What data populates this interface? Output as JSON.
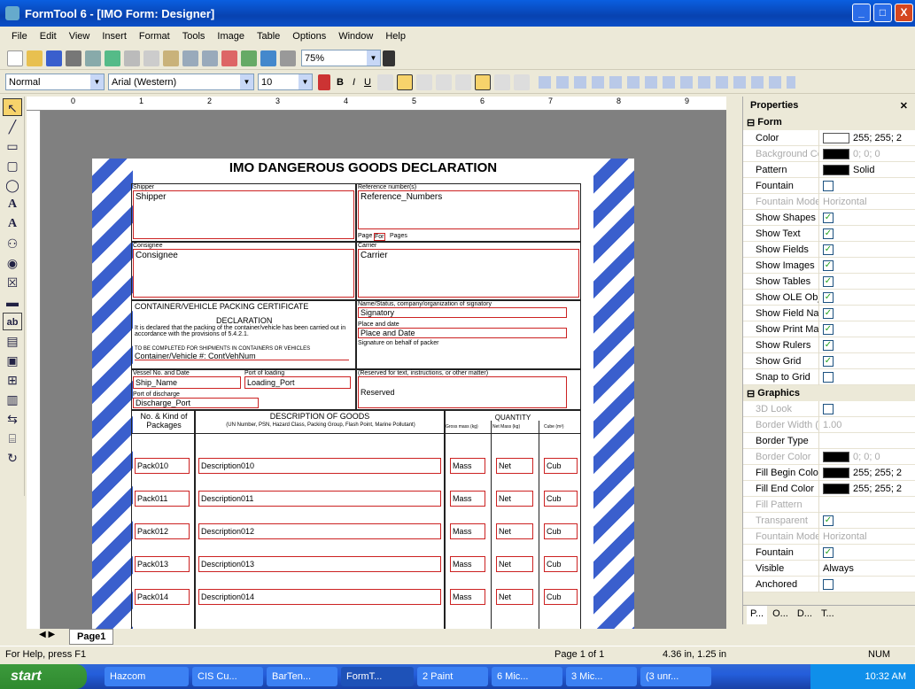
{
  "window": {
    "title": "FormTool 6 - [IMO Form: Designer]",
    "min": "_",
    "max": "□",
    "close": "X"
  },
  "menu": [
    "File",
    "Edit",
    "View",
    "Insert",
    "Format",
    "Tools",
    "Image",
    "Table",
    "Options",
    "Window",
    "Help"
  ],
  "toolbar": {
    "zoom": "75%",
    "style": "Normal",
    "font": "Arial (Western)",
    "size": "10"
  },
  "document": {
    "title": "IMO DANGEROUS GOODS DECLARATION",
    "shipper_label": "Shipper",
    "shipper_field": "Shipper",
    "ref_label": "Reference number(s)",
    "ref_field": "Reference_Numbers",
    "page_label": "Page",
    "page_for": "For",
    "page_pages": "Pages",
    "consignee_label": "Consignee",
    "consignee_field": "Consignee",
    "carrier_label": "Carrier",
    "carrier_field": "Carrier",
    "cert_heading": "CONTAINER/VEHICLE PACKING CERTIFICATE",
    "decl_heading": "DECLARATION",
    "decl_text": "It is declared that the packing of the container/vehicle has been carried out in accordance with the provisions of 5.4.2.1.",
    "sig_label": "Name/Status, company/organization of signatory",
    "sig_field": "Signatory",
    "place_label": "Place and date",
    "place_field": "Place and Date",
    "sig_behalf": "Signature on behalf of packer",
    "container_label": "TO BE COMPLETED FOR SHIPMENTS IN CONTAINERS OR VEHICLES",
    "container_field": "Container/Vehicle #:  ContVehNum",
    "vessel_label": "Vessel No. and Date",
    "vessel_field": "Ship_Name",
    "loading_label": "Port of loading",
    "loading_field": "Loading_Port",
    "discharge_label": "Port of discharge",
    "discharge_field": "Discharge_Port",
    "reserved_label": "(Reserved for text, instructions, or other matter)",
    "reserved_field": "Reserved",
    "col_packages": "No. & Kind of Packages",
    "col_desc": "DESCRIPTION OF GOODS",
    "col_desc_sub": "(UN Number, PSN, Hazard Class, Packing Group, Flash Point, Marine Pollutant)",
    "col_qty": "QUANTITY",
    "col_gross": "Gross mass (kg)",
    "col_net": "Net Mass (kg)",
    "col_cube": "Cube (m³)",
    "rows": [
      {
        "pack": "Pack010",
        "desc": "Description010",
        "mass": "Mass",
        "net": "Net",
        "cub": "Cub"
      },
      {
        "pack": "Pack011",
        "desc": "Description011",
        "mass": "Mass",
        "net": "Net",
        "cub": "Cub"
      },
      {
        "pack": "Pack012",
        "desc": "Description012",
        "mass": "Mass",
        "net": "Net",
        "cub": "Cub"
      },
      {
        "pack": "Pack013",
        "desc": "Description013",
        "mass": "Mass",
        "net": "Net",
        "cub": "Cub"
      },
      {
        "pack": "Pack014",
        "desc": "Description014",
        "mass": "Mass",
        "net": "Net",
        "cub": "Cub"
      }
    ]
  },
  "ruler": [
    "0",
    "1",
    "2",
    "3",
    "4",
    "5",
    "6",
    "7",
    "8",
    "9"
  ],
  "properties": {
    "title": "Properties",
    "cat_form": "Form",
    "cat_graphics": "Graphics",
    "form": [
      {
        "k": "Color",
        "v": "255; 255; 2",
        "sw": "#ffffff"
      },
      {
        "k": "Background Color",
        "v": "0; 0; 0",
        "sw": "#000000",
        "dim": true
      },
      {
        "k": "Pattern",
        "v": "Solid",
        "sw": "#000000"
      },
      {
        "k": "Fountain",
        "v": "",
        "chk": ""
      },
      {
        "k": "Fountain Mode",
        "v": "Horizontal",
        "dim": true
      },
      {
        "k": "Show Shapes",
        "chk": "✓"
      },
      {
        "k": "Show Text",
        "chk": "✓"
      },
      {
        "k": "Show Fields",
        "chk": "✓"
      },
      {
        "k": "Show Images",
        "chk": "✓"
      },
      {
        "k": "Show Tables",
        "chk": "✓"
      },
      {
        "k": "Show OLE Object",
        "chk": "✓"
      },
      {
        "k": "Show Field Names",
        "chk": "✓"
      },
      {
        "k": "Show Print Margin",
        "chk": "✓"
      },
      {
        "k": "Show Rulers",
        "chk": "✓"
      },
      {
        "k": "Show Grid",
        "chk": "✓"
      },
      {
        "k": "Snap to Grid",
        "chk": ""
      }
    ],
    "graphics": [
      {
        "k": "3D Look",
        "chk": "",
        "dim": true
      },
      {
        "k": "Border Width (pt.)",
        "v": "1.00",
        "dim": true
      },
      {
        "k": "Border Type",
        "v": ""
      },
      {
        "k": "Border Color",
        "v": "0; 0; 0",
        "sw": "#000000",
        "dim": true
      },
      {
        "k": "Fill Begin Color",
        "v": "255; 255; 2",
        "sw": "#000000"
      },
      {
        "k": "Fill End Color",
        "v": "255; 255; 2",
        "sw": "#000000"
      },
      {
        "k": "Fill Pattern",
        "v": "",
        "dim": true
      },
      {
        "k": "Transparent",
        "chk": "✓",
        "dim": true
      },
      {
        "k": "Fountain Mode",
        "v": "Horizontal",
        "dim": true
      },
      {
        "k": "Fountain",
        "chk": "✓"
      },
      {
        "k": "Visible",
        "v": "Always"
      },
      {
        "k": "Anchored",
        "chk": ""
      }
    ],
    "tabs": [
      "P...",
      "O...",
      "D...",
      "T..."
    ]
  },
  "sheet_tab": "Page1",
  "status": {
    "help": "For Help, press F1",
    "page": "Page 1 of 1",
    "pos": "4.36 in, 1.25 in",
    "num": "NUM"
  },
  "taskbar": {
    "start": "start",
    "items": [
      "Hazcom",
      "CIS Cu...",
      "BarTen...",
      "FormT...",
      "2 Paint",
      "6 Mic...",
      "3 Mic...",
      "(3 unr..."
    ],
    "clock": "10:32 AM"
  }
}
